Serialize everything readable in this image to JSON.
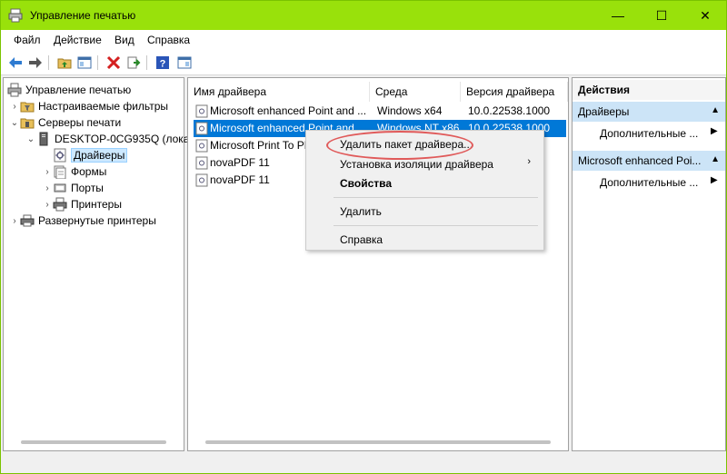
{
  "window": {
    "title": "Управление печатью",
    "controls": {
      "minimize": "—",
      "maximize": "☐",
      "close": "✕"
    }
  },
  "menu": [
    "Файл",
    "Действие",
    "Вид",
    "Справка"
  ],
  "tree": [
    {
      "label": "Управление печатью",
      "indent": 0,
      "arrow": "",
      "icon": "printer-mgmt-icon"
    },
    {
      "label": "Настраиваемые фильтры",
      "indent": 1,
      "arrow": "›",
      "icon": "filter-folder-icon"
    },
    {
      "label": "Серверы печати",
      "indent": 1,
      "arrow": "⌄",
      "icon": "server-folder-icon"
    },
    {
      "label": "DESKTOP-0CG935Q (лока",
      "indent": 2,
      "arrow": "⌄",
      "icon": "server-icon"
    },
    {
      "label": "Драйверы",
      "indent": 3,
      "arrow": "",
      "icon": "driver-icon",
      "selected": true
    },
    {
      "label": "Формы",
      "indent": 3,
      "arrow": "›",
      "icon": "forms-icon"
    },
    {
      "label": "Порты",
      "indent": 3,
      "arrow": "›",
      "icon": "ports-icon"
    },
    {
      "label": "Принтеры",
      "indent": 3,
      "arrow": "›",
      "icon": "printer-icon"
    },
    {
      "label": "Развернутые принтеры",
      "indent": 1,
      "arrow": "›",
      "icon": "deployed-printers-icon"
    }
  ],
  "list": {
    "columns": [
      "Имя драйвера",
      "Среда",
      "Версия драйвера"
    ],
    "rows": [
      {
        "name": "Microsoft enhanced Point and ...",
        "env": "Windows x64",
        "version": "10.0.22538.1000"
      },
      {
        "name": "Microsoft enhanced Point and ...",
        "env": "Windows NT x86",
        "version": "10.0.22538.1000",
        "selected": true
      },
      {
        "name": "Microsoft Print To PDF",
        "env": "",
        "version": ""
      },
      {
        "name": "novaPDF 11",
        "env": "",
        "version": ""
      },
      {
        "name": "novaPDF 11",
        "env": "",
        "version": ""
      }
    ]
  },
  "actions": {
    "title": "Действия",
    "sections": [
      {
        "header": "Драйверы",
        "item": "Дополнительные ..."
      },
      {
        "header": "Microsoft enhanced Poi...",
        "item": "Дополнительные ..."
      }
    ]
  },
  "context_menu": {
    "items": [
      {
        "label": "Удалить пакет драйвера...",
        "bold": false
      },
      {
        "label": "Установка изоляции драйвера",
        "bold": false,
        "submenu": true
      },
      {
        "label": "Свойства",
        "bold": true
      },
      {
        "label": "Удалить",
        "bold": false
      },
      {
        "label": "Справка",
        "bold": false
      }
    ],
    "submenu_arrow": "›"
  },
  "colors": {
    "titlebar": "#99e10b",
    "selection": "#0078d7",
    "tree_selection": "#cce8ff",
    "action_header": "#cce4f7",
    "annotation": "#e05a5a"
  }
}
